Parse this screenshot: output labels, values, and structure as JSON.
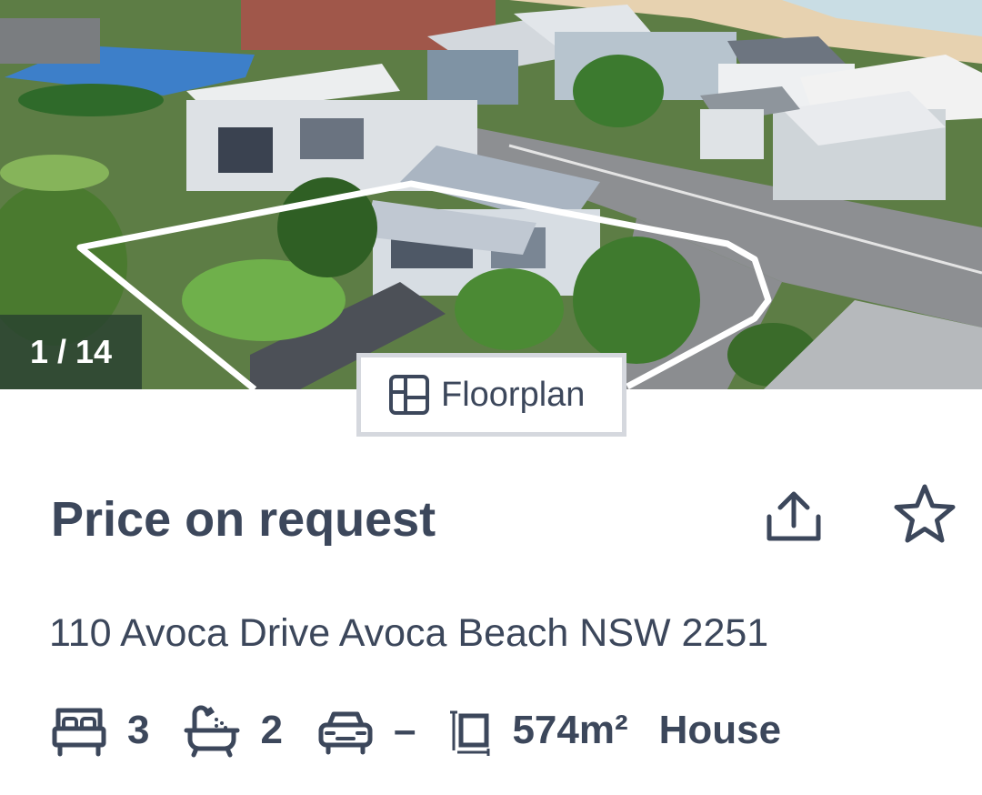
{
  "gallery": {
    "counter": "1 / 14",
    "floorplan_label": "Floorplan"
  },
  "listing": {
    "price": "Price on request",
    "address": "110 Avoca Drive Avoca Beach NSW 2251",
    "bedrooms": "3",
    "bathrooms": "2",
    "parking": "–",
    "land_size": "574m²",
    "property_type": "House"
  },
  "icons": {
    "floorplan": "floorplan-icon",
    "share": "share-icon",
    "favourite": "star-icon",
    "bed": "bed-icon",
    "bath": "bath-icon",
    "car": "car-icon",
    "land": "land-size-icon"
  },
  "colors": {
    "text": "#3c475b",
    "counter_bg": "#263e30",
    "button_border": "#d5d8de"
  }
}
